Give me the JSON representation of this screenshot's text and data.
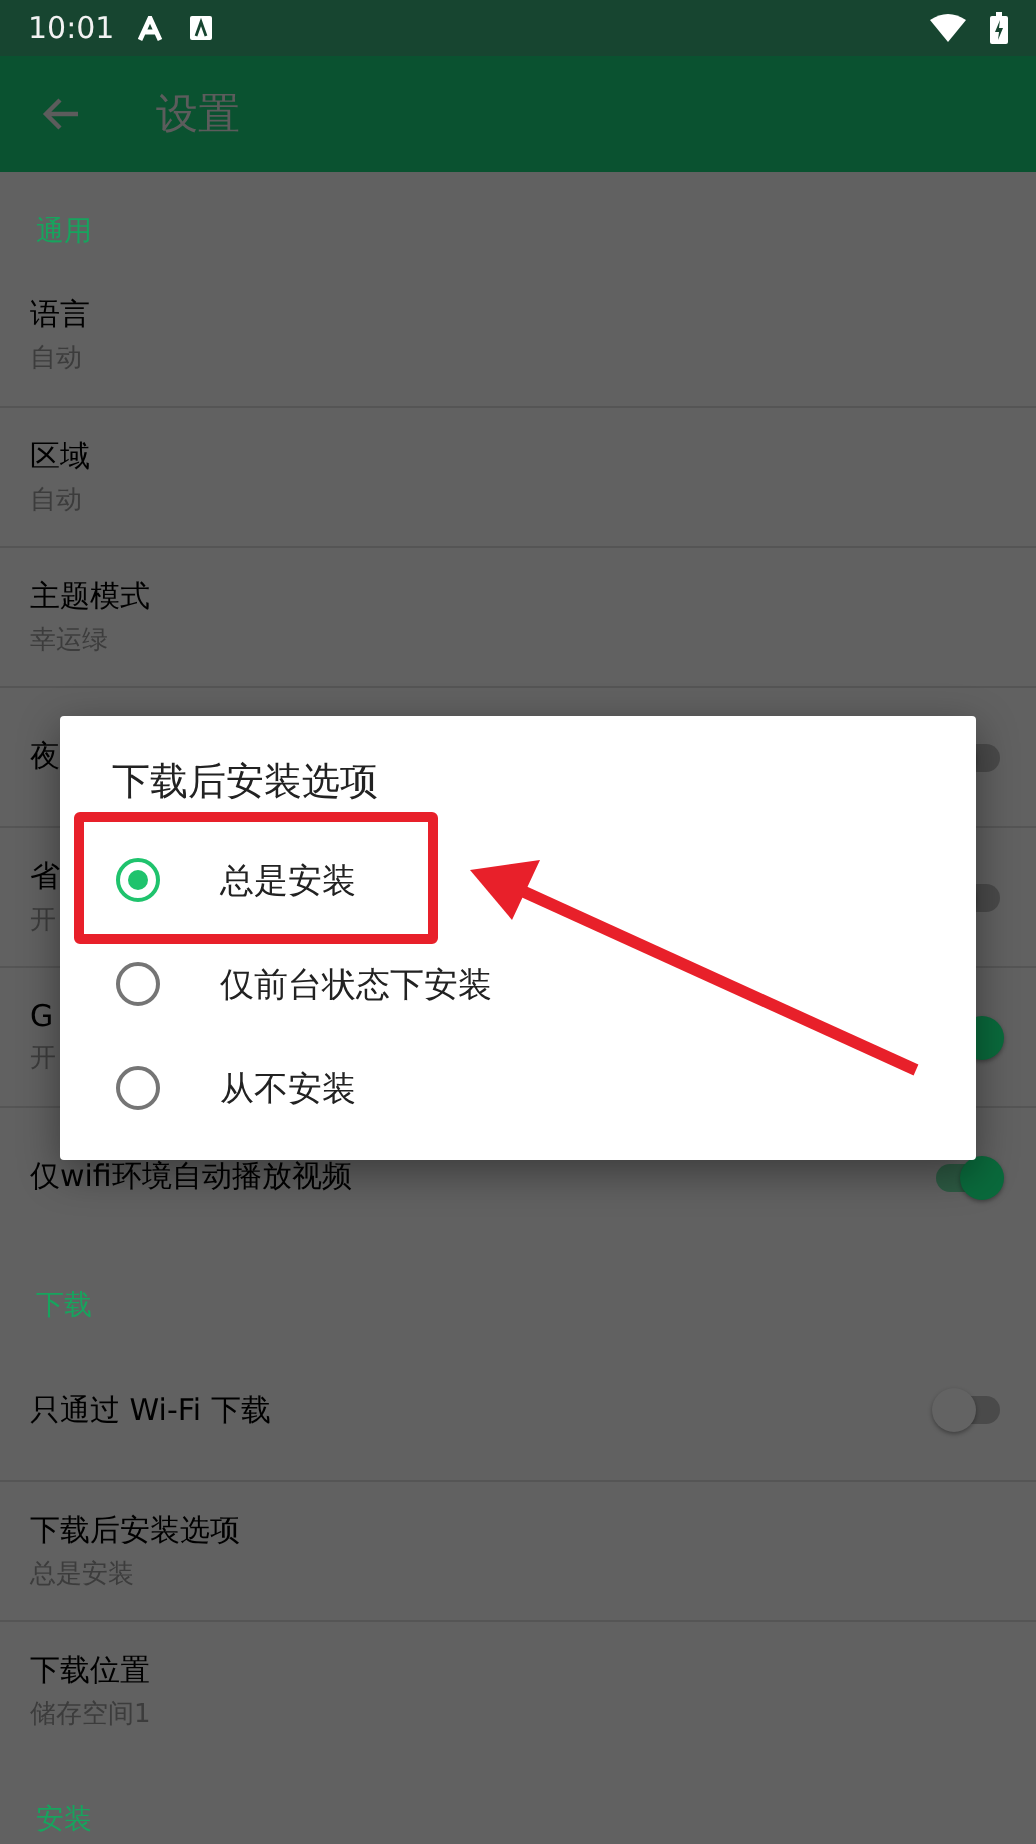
{
  "status_bar": {
    "time": "10:01"
  },
  "toolbar": {
    "title": "设置"
  },
  "sections": [
    {
      "header": "通用",
      "rows": [
        {
          "kind": "text",
          "title": "语言",
          "subtitle": "自动"
        },
        {
          "kind": "text",
          "title": "区域",
          "subtitle": "自动"
        },
        {
          "kind": "text",
          "title": "主题模式",
          "subtitle": "幸运绿"
        },
        {
          "kind": "switch",
          "title": "夜",
          "on": false
        },
        {
          "kind": "switch",
          "title": "省",
          "subtitle": "开",
          "on": false
        },
        {
          "kind": "switch",
          "title": "G",
          "subtitle": "开",
          "on": true
        },
        {
          "kind": "switch",
          "title": "仅wifi环境自动播放视频",
          "on": true
        }
      ]
    },
    {
      "header": "下载",
      "rows": [
        {
          "kind": "switch",
          "title": "只通过 Wi-Fi 下载",
          "on": false
        },
        {
          "kind": "text",
          "title": "下载后安装选项",
          "subtitle": "总是安装"
        },
        {
          "kind": "text",
          "title": "下载位置",
          "subtitle": "储存空间1"
        }
      ]
    },
    {
      "header": "安装"
    }
  ],
  "dialog": {
    "title": "下载后安装选项",
    "options": [
      {
        "label": "总是安装",
        "selected": true
      },
      {
        "label": "仅前台状态下安装",
        "selected": false
      },
      {
        "label": "从不安装",
        "selected": false
      }
    ]
  }
}
